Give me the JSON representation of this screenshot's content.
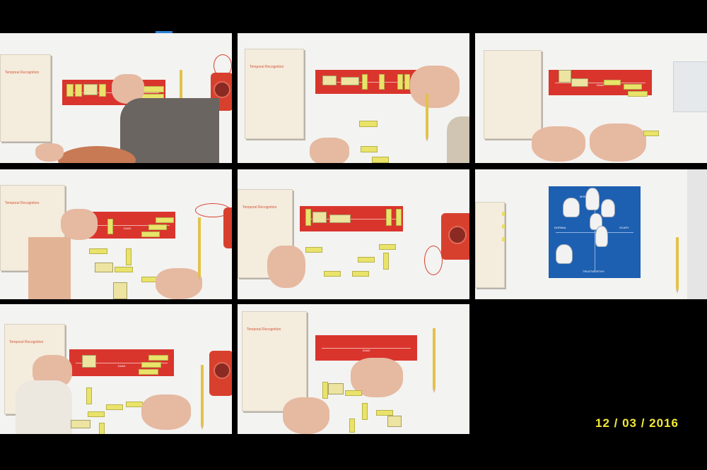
{
  "frames": [
    {
      "paper_title": "Temporal Recognition",
      "board_label": ""
    },
    {
      "paper_title": "Temporal Recognition",
      "board_label": ""
    },
    {
      "paper_title": "",
      "board_label": "ZAAD"
    },
    {
      "paper_title": "Temporal Recognition",
      "board_label": "ZAAD"
    },
    {
      "paper_title": "Temporal Recognition",
      "board_label": ""
    },
    {
      "paper_title": "",
      "board_label": ""
    },
    {
      "paper_title": "Temporal Recognition",
      "board_label": "ZAAD"
    },
    {
      "paper_title": "Temporal Recognition",
      "board_label": "ZAAD"
    }
  ],
  "blue_board": {
    "top_label": "MISCHIEVOUS",
    "left_label": "NORMAL",
    "right_label": "SCARY",
    "bottom_label": "TRUSTWORTHY"
  },
  "date_stamp": "12 / 03 / 2016",
  "colors": {
    "background": "#000000",
    "board_red": "#d9352d",
    "board_blue": "#1d5fb0",
    "date_yellow": "#f2e838",
    "tag_yellow": "#e9e36a"
  }
}
